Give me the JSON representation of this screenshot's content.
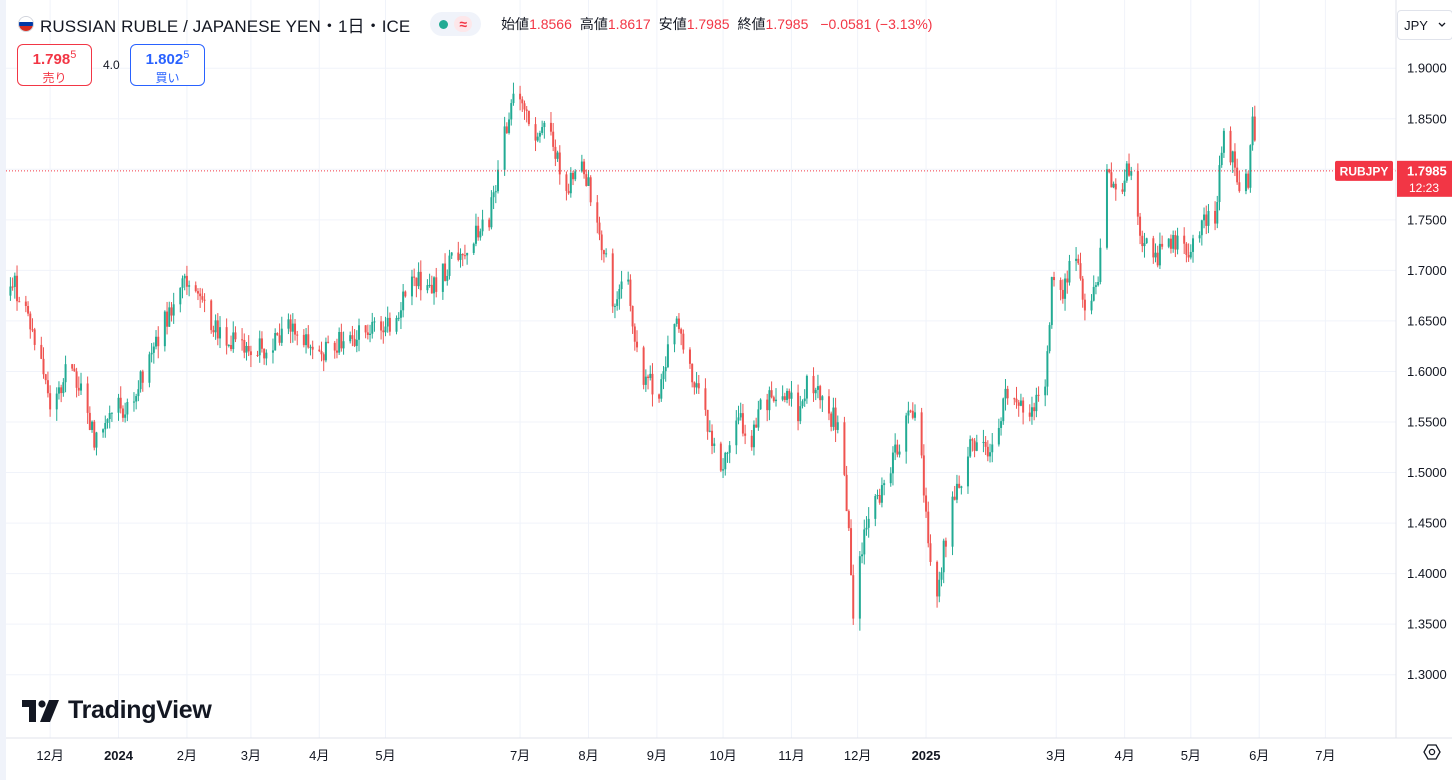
{
  "header": {
    "title": "RUSSIAN RUBLE / JAPANESE YEN・1日・ICE",
    "wave_icon": "≈",
    "ohlc": [
      {
        "label": "始値",
        "value": "1.8566"
      },
      {
        "label": "高値",
        "value": "1.8617"
      },
      {
        "label": "安値",
        "value": "1.7985"
      },
      {
        "label": "終値",
        "value": "1.7985"
      }
    ],
    "change": "−0.0581 (−3.13%)"
  },
  "trade": {
    "sell_price": "1.798",
    "sell_price_small": "5",
    "sell_label": "売り",
    "spread": "4.0",
    "buy_price": "1.802",
    "buy_price_small": "5",
    "buy_label": "買い"
  },
  "currency_selector": {
    "value": "JPY",
    "chevron_icon": "chevron-down-icon"
  },
  "logo": {
    "text": "TradingView"
  },
  "colors": {
    "up": "#22ab94",
    "down": "#ef5350",
    "grid": "#f0f3fa",
    "price_line": "#f23645"
  },
  "chart_data": {
    "type": "candlestick",
    "symbol_label": "RUBJPY",
    "last_price": "1.7985",
    "countdown": "12:23",
    "ylim": [
      1.275,
      1.92
    ],
    "y_ticks": [
      "1.9000",
      "1.8500",
      "1.8000",
      "1.7500",
      "1.7000",
      "1.6500",
      "1.6000",
      "1.5500",
      "1.5000",
      "1.4500",
      "1.4000",
      "1.3500",
      "1.3000"
    ],
    "y_ticks_values": [
      1.9,
      1.85,
      1.8,
      1.75,
      1.7,
      1.65,
      1.6,
      1.55,
      1.5,
      1.45,
      1.4,
      1.35,
      1.3
    ],
    "x_ticks": [
      {
        "label": "12月",
        "date": "2023-12-01",
        "bold": false
      },
      {
        "label": "2024",
        "date": "2024-01-01",
        "bold": true
      },
      {
        "label": "2月",
        "date": "2024-02-01",
        "bold": false
      },
      {
        "label": "3月",
        "date": "2024-03-01",
        "bold": false
      },
      {
        "label": "4月",
        "date": "2024-04-01",
        "bold": false
      },
      {
        "label": "5月",
        "date": "2024-05-01",
        "bold": false
      },
      {
        "label": "7月",
        "date": "2024-07-01",
        "bold": false
      },
      {
        "label": "8月",
        "date": "2024-08-01",
        "bold": false
      },
      {
        "label": "9月",
        "date": "2024-09-01",
        "bold": false
      },
      {
        "label": "10月",
        "date": "2024-10-01",
        "bold": false
      },
      {
        "label": "11月",
        "date": "2024-11-01",
        "bold": false
      },
      {
        "label": "12月",
        "date": "2024-12-01",
        "bold": false
      },
      {
        "label": "2025",
        "date": "2025-01-01",
        "bold": true
      },
      {
        "label": "3月",
        "date": "2025-03-01",
        "bold": false
      },
      {
        "label": "4月",
        "date": "2025-04-01",
        "bold": false
      },
      {
        "label": "5月",
        "date": "2025-05-01",
        "bold": false
      },
      {
        "label": "6月",
        "date": "2025-06-01",
        "bold": false
      },
      {
        "label": "7月",
        "date": "2025-07-01",
        "bold": false
      }
    ],
    "x_range": [
      "2023-11-11",
      "2025-08-02"
    ],
    "candle_width_days": 0.7,
    "wick_days": 0.17,
    "anchors": [
      [
        "2023-11-11",
        1.675
      ],
      [
        "2023-11-14",
        1.695
      ],
      [
        "2023-11-22",
        1.655
      ],
      [
        "2023-11-28",
        1.61
      ],
      [
        "2023-12-03",
        1.558
      ],
      [
        "2023-12-10",
        1.61
      ],
      [
        "2023-12-18",
        1.57
      ],
      [
        "2023-12-22",
        1.532
      ],
      [
        "2024-01-02",
        1.565
      ],
      [
        "2024-01-08",
        1.565
      ],
      [
        "2024-01-15",
        1.61
      ],
      [
        "2024-01-23",
        1.65
      ],
      [
        "2024-02-02",
        1.69
      ],
      [
        "2024-02-10",
        1.66
      ],
      [
        "2024-02-20",
        1.632
      ],
      [
        "2024-03-01",
        1.62
      ],
      [
        "2024-03-12",
        1.625
      ],
      [
        "2024-03-20",
        1.645
      ],
      [
        "2024-03-31",
        1.615
      ],
      [
        "2024-04-15",
        1.635
      ],
      [
        "2024-04-30",
        1.64
      ],
      [
        "2024-05-08",
        1.66
      ],
      [
        "2024-05-15",
        1.695
      ],
      [
        "2024-05-22",
        1.68
      ],
      [
        "2024-06-05",
        1.72
      ],
      [
        "2024-06-18",
        1.75
      ],
      [
        "2024-06-24",
        1.82
      ],
      [
        "2024-06-28",
        1.87
      ],
      [
        "2024-07-03",
        1.86
      ],
      [
        "2024-07-10",
        1.822
      ],
      [
        "2024-07-15",
        1.85
      ],
      [
        "2024-07-22",
        1.78
      ],
      [
        "2024-07-31",
        1.8
      ],
      [
        "2024-08-08",
        1.73
      ],
      [
        "2024-08-14",
        1.66
      ],
      [
        "2024-08-19",
        1.7
      ],
      [
        "2024-08-25",
        1.6
      ],
      [
        "2024-09-03",
        1.58
      ],
      [
        "2024-09-10",
        1.65
      ],
      [
        "2024-09-17",
        1.6
      ],
      [
        "2024-09-25",
        1.545
      ],
      [
        "2024-10-01",
        1.5
      ],
      [
        "2024-10-08",
        1.555
      ],
      [
        "2024-10-15",
        1.535
      ],
      [
        "2024-10-20",
        1.57
      ],
      [
        "2024-11-01",
        1.575
      ],
      [
        "2024-11-05",
        1.55
      ],
      [
        "2024-11-10",
        1.595
      ],
      [
        "2024-11-17",
        1.56
      ],
      [
        "2024-11-23",
        1.55
      ],
      [
        "2024-11-28",
        1.45
      ],
      [
        "2024-11-30",
        1.36
      ],
      [
        "2024-12-02",
        1.415
      ],
      [
        "2024-12-10",
        1.47
      ],
      [
        "2024-12-20",
        1.525
      ],
      [
        "2024-12-29",
        1.575
      ],
      [
        "2025-01-03",
        1.42
      ],
      [
        "2025-01-07",
        1.385
      ],
      [
        "2025-01-13",
        1.46
      ],
      [
        "2025-01-22",
        1.525
      ],
      [
        "2025-01-30",
        1.52
      ],
      [
        "2025-02-08",
        1.58
      ],
      [
        "2025-02-14",
        1.565
      ],
      [
        "2025-02-18",
        1.56
      ],
      [
        "2025-02-25",
        1.58
      ],
      [
        "2025-02-28",
        1.69
      ],
      [
        "2025-03-05",
        1.68
      ],
      [
        "2025-03-10",
        1.725
      ],
      [
        "2025-03-15",
        1.655
      ],
      [
        "2025-03-21",
        1.69
      ],
      [
        "2025-03-25",
        1.79
      ],
      [
        "2025-03-30",
        1.78
      ],
      [
        "2025-04-04",
        1.8
      ],
      [
        "2025-04-09",
        1.74
      ],
      [
        "2025-04-15",
        1.705
      ],
      [
        "2025-04-22",
        1.73
      ],
      [
        "2025-04-30",
        1.72
      ],
      [
        "2025-05-08",
        1.75
      ],
      [
        "2025-05-13",
        1.755
      ],
      [
        "2025-05-17",
        1.84
      ],
      [
        "2025-05-21",
        1.81
      ],
      [
        "2025-05-24",
        1.785
      ],
      [
        "2025-05-28",
        1.79
      ],
      [
        "2025-05-30",
        1.862
      ],
      [
        "2025-06-01",
        1.7985
      ]
    ]
  }
}
